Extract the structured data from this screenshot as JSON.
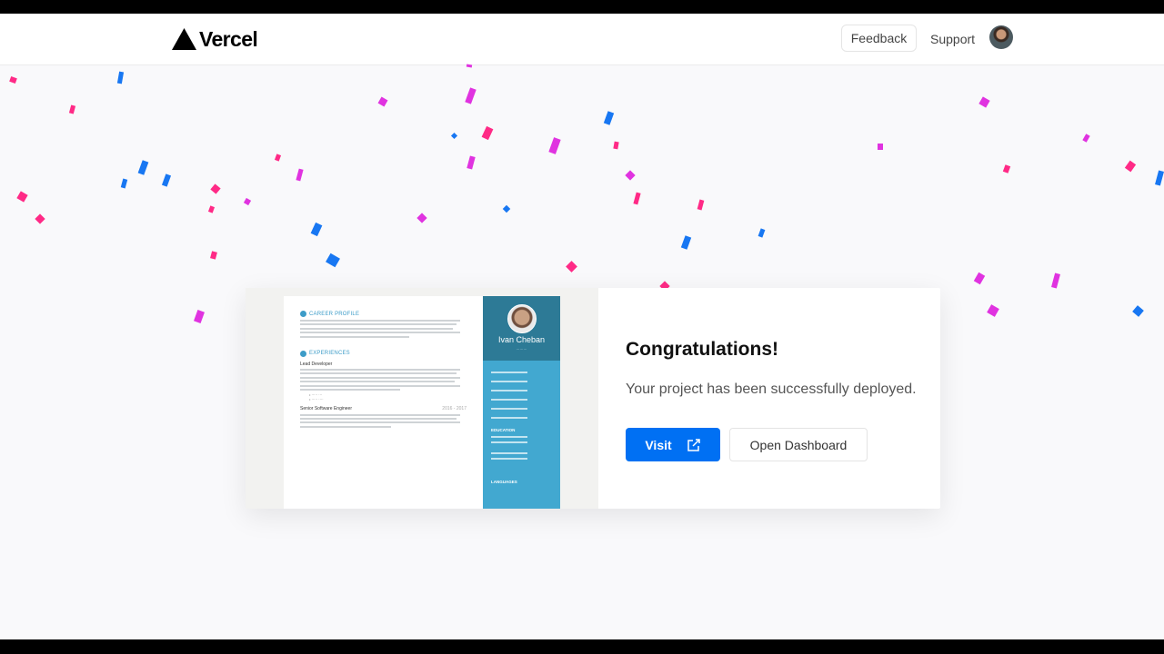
{
  "header": {
    "brand": "Vercel",
    "feedback_label": "Feedback",
    "support_label": "Support"
  },
  "card": {
    "title": "Congratulations!",
    "message": "Your project has been successfully deployed.",
    "visit_label": "Visit",
    "dashboard_label": "Open Dashboard"
  },
  "preview": {
    "section_career": "CAREER PROFILE",
    "section_experiences": "EXPERIENCES",
    "job_1": "Lead Developer",
    "job_2": "Senior Software Engineer",
    "job_2_years": "2016 - 2017",
    "name": "Ivan Cheban",
    "side_education": "EDUCATION",
    "side_languages": "LANGUAGES"
  },
  "colors": {
    "accent": "#0070f3",
    "confetti_pink": "#ff2a86",
    "confetti_magenta": "#e033e0",
    "confetti_blue": "#1877f2",
    "resume_sidebar": "#42a8d0"
  }
}
